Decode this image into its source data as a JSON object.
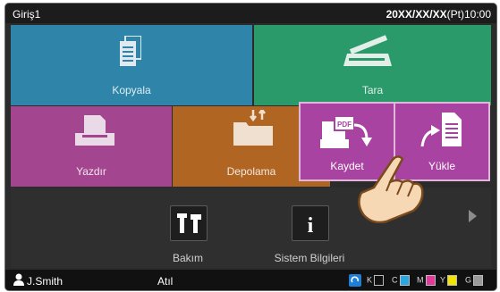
{
  "header": {
    "title": "Giriş1",
    "datetime": "20XX/XX/XX",
    "period": "(Pt)",
    "time": "10:00"
  },
  "tiles": {
    "copy": "Kopyala",
    "scan": "Tara",
    "print": "Yazdır",
    "storage": "Depolama",
    "save": "Kaydet",
    "upload": "Yükle"
  },
  "save_pdf_badge": "PDF",
  "lower": {
    "maintenance": "Bakım",
    "system_info": "Sistem Bilgileri"
  },
  "status": {
    "user": "J.Smith",
    "mode": "Atıl",
    "toner": [
      {
        "letter": "K",
        "color": "#1a1a1a",
        "level": 0.0
      },
      {
        "letter": "C",
        "color": "#2aa7e0",
        "level": 1.0
      },
      {
        "letter": "M",
        "color": "#e23a9a",
        "level": 1.0
      },
      {
        "letter": "Y",
        "color": "#f5e300",
        "level": 1.0
      },
      {
        "letter": "G",
        "color": "#9a9a9a",
        "level": 1.0
      }
    ]
  },
  "colors": {
    "copy": "#2e85a9",
    "scan": "#2b9a6b",
    "print": "#a3468f",
    "storage": "#b06622",
    "selected": "#a843a1"
  }
}
